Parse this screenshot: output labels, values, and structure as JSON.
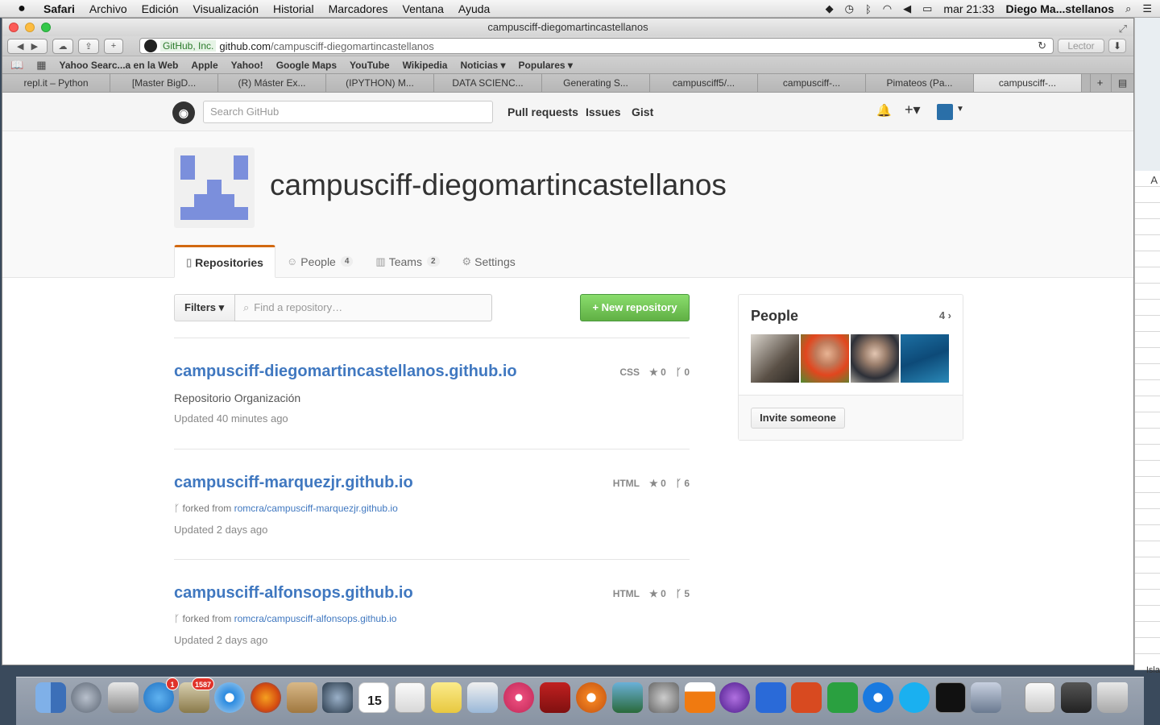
{
  "menubar": {
    "apple": "",
    "app": "Safari",
    "items": [
      "Archivo",
      "Edición",
      "Visualización",
      "Historial",
      "Marcadores",
      "Ventana",
      "Ayuda"
    ],
    "clock": "mar 21:33",
    "user": "Diego Ma...stellanos"
  },
  "window": {
    "title": "campusciff-diegomartincastellanos"
  },
  "toolbar": {
    "cert": "GitHub, Inc.",
    "url_host": "github.com",
    "url_path": "/campusciff-diegomartincastellanos",
    "reader": "Lector"
  },
  "bookmarks": [
    "Yahoo Searc...a en la Web",
    "Apple",
    "Yahoo!",
    "Google Maps",
    "YouTube",
    "Wikipedia",
    "Noticias ▾",
    "Populares ▾"
  ],
  "tabs": [
    "repl.it – Python",
    "[Master BigD...",
    "(R) Máster Ex...",
    "(IPYTHON) M...",
    "DATA SCIENC...",
    "Generating S...",
    "campusciff5/...",
    "campusciff-...",
    "Pimateos (Pa...",
    "campusciff-..."
  ],
  "github": {
    "search_placeholder": "Search GitHub",
    "nav": [
      "Pull requests",
      "Issues",
      "Gist"
    ]
  },
  "org": {
    "name": "campusciff-diegomartincastellanos",
    "tabs": {
      "repositories": "Repositories",
      "people": "People",
      "people_count": "4",
      "teams": "Teams",
      "teams_count": "2",
      "settings": "Settings"
    }
  },
  "controls": {
    "filters": "Filters ▾",
    "find_placeholder": "Find a repository…",
    "new_repo": "+ New repository"
  },
  "repos": [
    {
      "name": "campusciff-diegomartincastellanos.github.io",
      "lang": "CSS",
      "stars": "★ 0",
      "forks": "ᚴ 0",
      "desc": "Repositorio Organización",
      "updated": "Updated 40 minutes ago"
    },
    {
      "name": "campusciff-marquezjr.github.io",
      "lang": "HTML",
      "stars": "★ 0",
      "forks": "ᚴ 6",
      "fork_prefix": "forked from ",
      "fork_src": "romcra/campusciff-marquezjr.github.io",
      "updated": "Updated 2 days ago"
    },
    {
      "name": "campusciff-alfonsops.github.io",
      "lang": "HTML",
      "stars": "★ 0",
      "forks": "ᚴ 5",
      "fork_prefix": "forked from ",
      "fork_src": "romcra/campusciff-alfonsops.github.io",
      "updated": "Updated 2 days ago"
    }
  ],
  "people_box": {
    "title": "People",
    "count": "4 ›",
    "invite": "Invite someone"
  },
  "desktop": {
    "col_header": "A",
    "cell_text": "Isla"
  },
  "dock": {
    "appstore_badge": "1",
    "mail_badge": "1587",
    "calendar_day": "15"
  }
}
